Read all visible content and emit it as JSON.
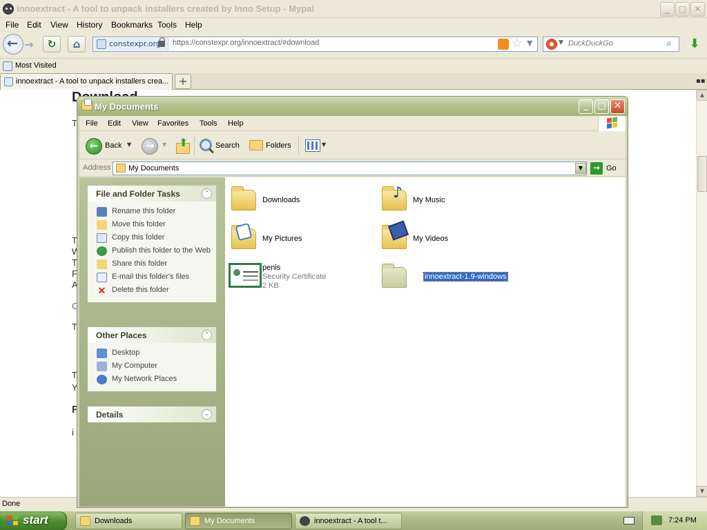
{
  "browser": {
    "title": "innoextract - A tool to unpack installers created by Inno Setup - Mypal",
    "window_buttons": {
      "minimize": "_",
      "maximize": "□",
      "close": "✕"
    },
    "menu": [
      "File",
      "Edit",
      "View",
      "History",
      "Bookmarks",
      "Tools",
      "Help"
    ],
    "identity": "constexpr.org",
    "url": "https://constexpr.org/innoextract/#download",
    "search_placeholder": "DuckDuckGo",
    "bookmark": "Most Visited",
    "tab_label": "innoextract - A tool to unpack installers crea...",
    "page": {
      "heading": "Download",
      "fragments": [
        "T",
        "T",
        "W",
        "T",
        "F",
        "A",
        "C",
        "T",
        "T",
        "Y",
        "F",
        "i"
      ]
    },
    "status": "Done"
  },
  "explorer": {
    "title": "My Documents",
    "window_buttons": {
      "minimize": "_",
      "maximize": "□",
      "close": "✕"
    },
    "menu": [
      "File",
      "Edit",
      "View",
      "Favorites",
      "Tools",
      "Help"
    ],
    "toolbar": {
      "back": "Back",
      "search": "Search",
      "folders": "Folders"
    },
    "address_label": "Address",
    "address_value": "My Documents",
    "go": "Go",
    "panels": {
      "tasks": {
        "title": "File and Folder Tasks",
        "items": [
          "Rename this folder",
          "Move this folder",
          "Copy this folder",
          "Publish this folder to the Web",
          "Share this folder",
          "E-mail this folder's files",
          "Delete this folder"
        ]
      },
      "places": {
        "title": "Other Places",
        "items": [
          "Desktop",
          "My Computer",
          "My Network Places"
        ]
      },
      "details": {
        "title": "Details"
      }
    },
    "items": [
      {
        "name": "Downloads"
      },
      {
        "name": "My Music"
      },
      {
        "name": "My Pictures"
      },
      {
        "name": "My Videos"
      },
      {
        "name": "penis",
        "type": "Security Certificate",
        "size": "2 KB"
      },
      {
        "name": "innoextract-1.9-windows"
      }
    ]
  },
  "taskbar": {
    "start": "start",
    "buttons": [
      "Downloads",
      "My Documents",
      "innoextract - A tool t..."
    ],
    "active": "My Documents",
    "clock": "7:24 PM"
  }
}
